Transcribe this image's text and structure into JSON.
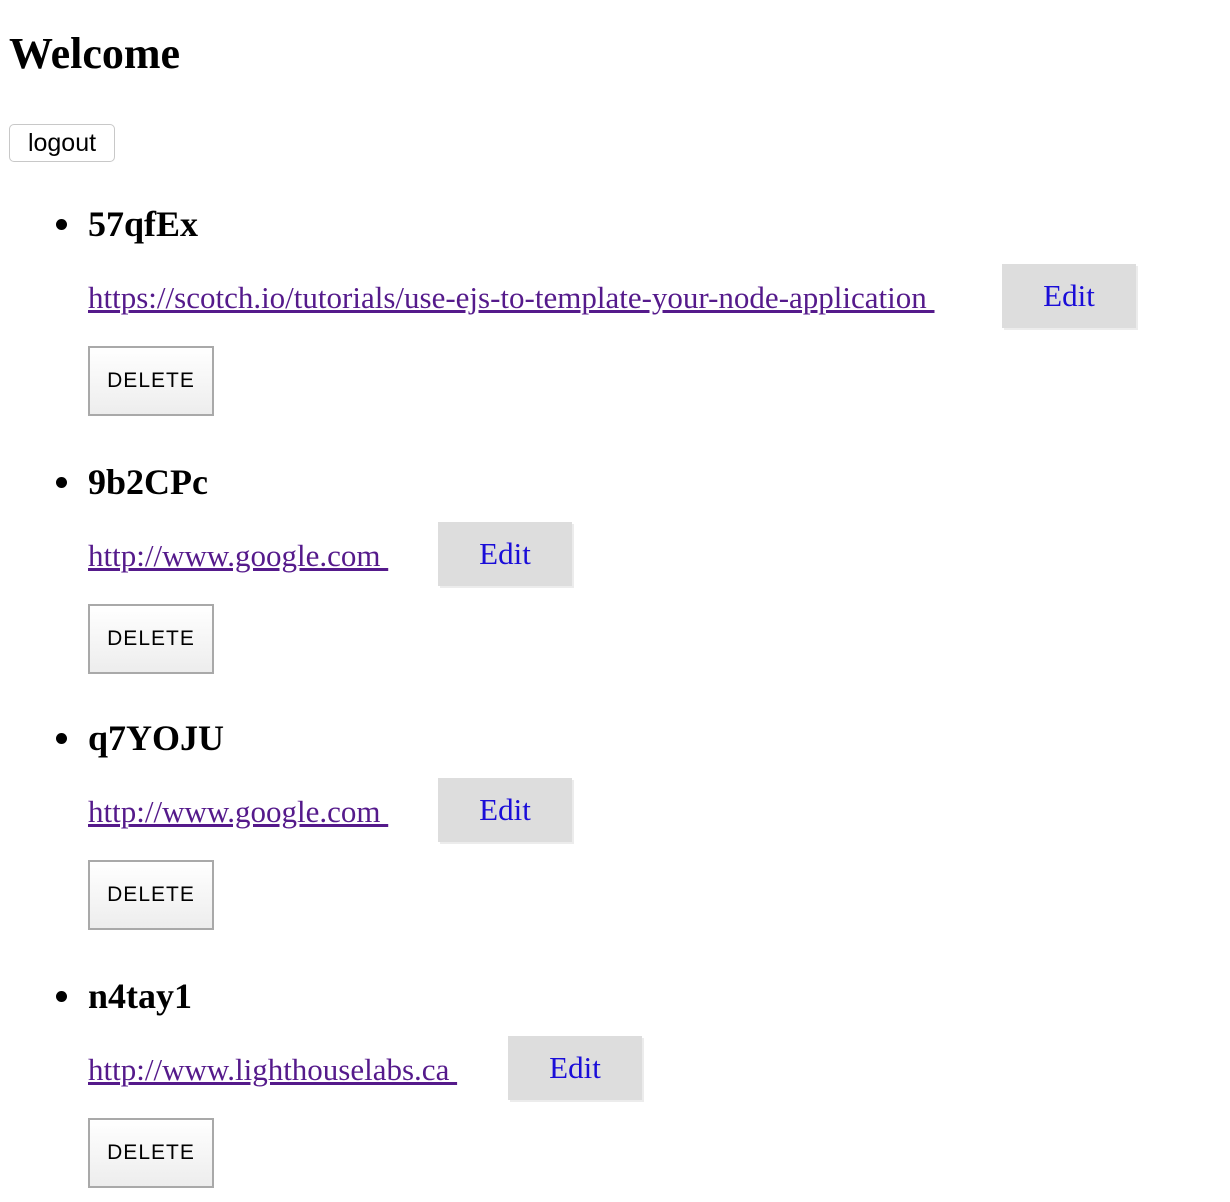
{
  "page": {
    "title": "Welcome",
    "logout_label": "logout"
  },
  "urls": [
    {
      "short_code": "57qfEx",
      "long_url": "https://scotch.io/tutorials/use-ejs-to-template-your-node-application ",
      "edit_label": "Edit",
      "delete_label": "DELETE"
    },
    {
      "short_code": "9b2CPc",
      "long_url": "http://www.google.com ",
      "edit_label": "Edit",
      "delete_label": "DELETE"
    },
    {
      "short_code": "q7YOJU",
      "long_url": "http://www.google.com ",
      "edit_label": "Edit",
      "delete_label": "DELETE"
    },
    {
      "short_code": "n4tay1",
      "long_url": "http://www.lighthouselabs.ca ",
      "edit_label": "Edit",
      "delete_label": "DELETE"
    }
  ],
  "colors": {
    "link_visited": "#551a8b",
    "edit_text": "#1a0dd8",
    "edit_background": "#dddddd"
  }
}
